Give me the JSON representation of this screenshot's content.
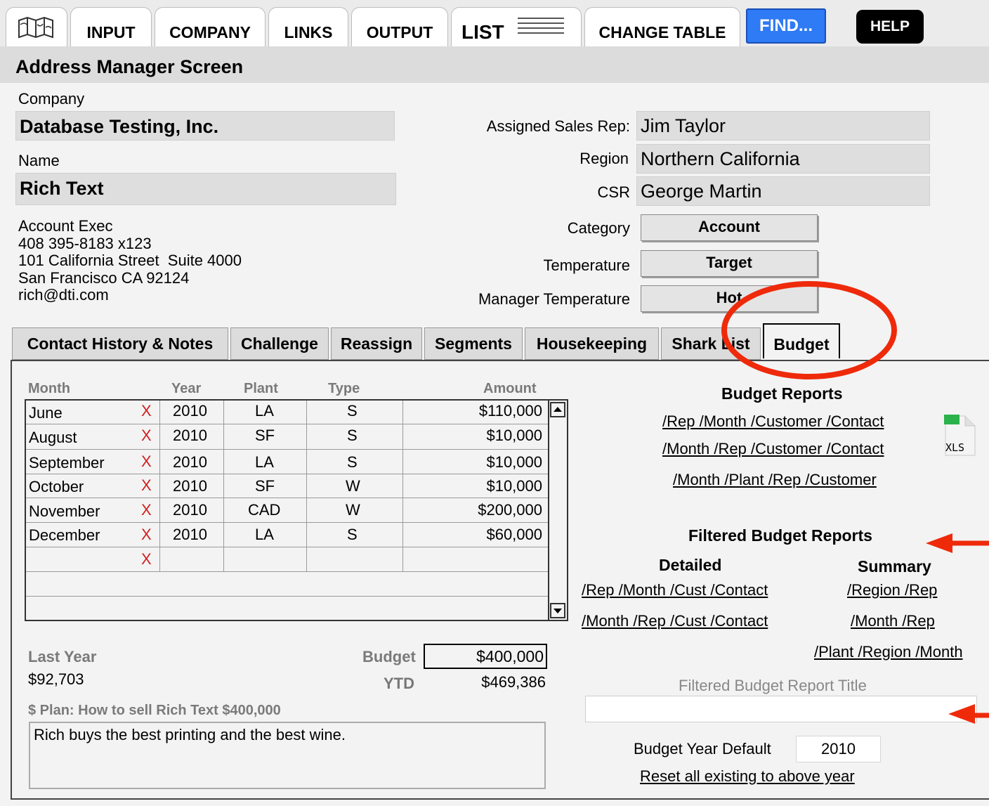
{
  "top_tabs": {
    "input": "INPUT",
    "company": "COMPANY",
    "links": "LINKS",
    "output": "OUTPUT",
    "list": "LIST",
    "change_table": "CHANGE TABLE",
    "find": "FIND...",
    "help": "HELP"
  },
  "header": {
    "title": "Address Manager Screen"
  },
  "company": {
    "label": "Company",
    "value": "Database Testing, Inc."
  },
  "name": {
    "label": "Name",
    "value": "Rich Text"
  },
  "contact_info": [
    "Account Exec",
    "408 395-8183 x123",
    "101 California Street  Suite 4000",
    "San Francisco CA 92124",
    "rich@dti.com"
  ],
  "assignment": {
    "sales_rep_label": "Assigned Sales Rep:",
    "sales_rep": "Jim Taylor",
    "region_label": "Region",
    "region": "Northern California",
    "csr_label": "CSR",
    "csr": "George Martin",
    "category_label": "Category",
    "category": "Account",
    "temperature_label": "Temperature",
    "temperature": "Target",
    "manager_temperature_label": "Manager Temperature",
    "manager_temperature": "Hot"
  },
  "section_tabs": [
    "Contact History & Notes",
    "Challenge",
    "Reassign",
    "Segments",
    "Housekeeping",
    "Shark List",
    "Budget"
  ],
  "budget_table": {
    "columns": [
      "Month",
      "Year",
      "Plant",
      "Type",
      "Amount"
    ],
    "rows": [
      {
        "month": "June",
        "year": "2010",
        "plant": "LA",
        "type": "S",
        "amount": "$110,000"
      },
      {
        "month": "August",
        "year": "2010",
        "plant": "SF",
        "type": "S",
        "amount": "$10,000"
      },
      {
        "month": "September",
        "year": "2010",
        "plant": "LA",
        "type": "S",
        "amount": "$10,000"
      },
      {
        "month": "October",
        "year": "2010",
        "plant": "SF",
        "type": "W",
        "amount": "$10,000"
      },
      {
        "month": "November",
        "year": "2010",
        "plant": "CAD",
        "type": "W",
        "amount": "$200,000"
      },
      {
        "month": "December",
        "year": "2010",
        "plant": "LA",
        "type": "S",
        "amount": "$60,000"
      }
    ],
    "delete_mark": "X"
  },
  "totals": {
    "last_year_label": "Last Year",
    "last_year": "$92,703",
    "budget_label": "Budget",
    "budget": "$400,000",
    "ytd_label": "YTD",
    "ytd": "$469,386"
  },
  "plan": {
    "label": "$ Plan: How to sell Rich Text $400,000",
    "text": "Rich buys the best printing and the best wine."
  },
  "budget_reports": {
    "title": "Budget Reports",
    "links": [
      "/Rep /Month /Customer /Contact",
      "/Month /Rep /Customer /Contact",
      "/Month /Plant /Rep /Customer"
    ],
    "xls_label": "XLS"
  },
  "filtered_reports": {
    "title": "Filtered Budget Reports",
    "detailed_title": "Detailed",
    "detailed_links": [
      "/Rep /Month /Cust /Contact",
      "/Month /Rep /Cust /Contact"
    ],
    "summary_title": "Summary",
    "summary_links": [
      "/Region /Rep",
      "/Month /Rep",
      "/Plant /Region /Month"
    ],
    "report_title_label": "Filtered Budget Report Title",
    "report_title_value": ""
  },
  "budget_year": {
    "label": "Budget Year Default",
    "value": "2010",
    "reset_link": "Reset all existing to above year"
  },
  "annotation_color": "#ee2a0b"
}
